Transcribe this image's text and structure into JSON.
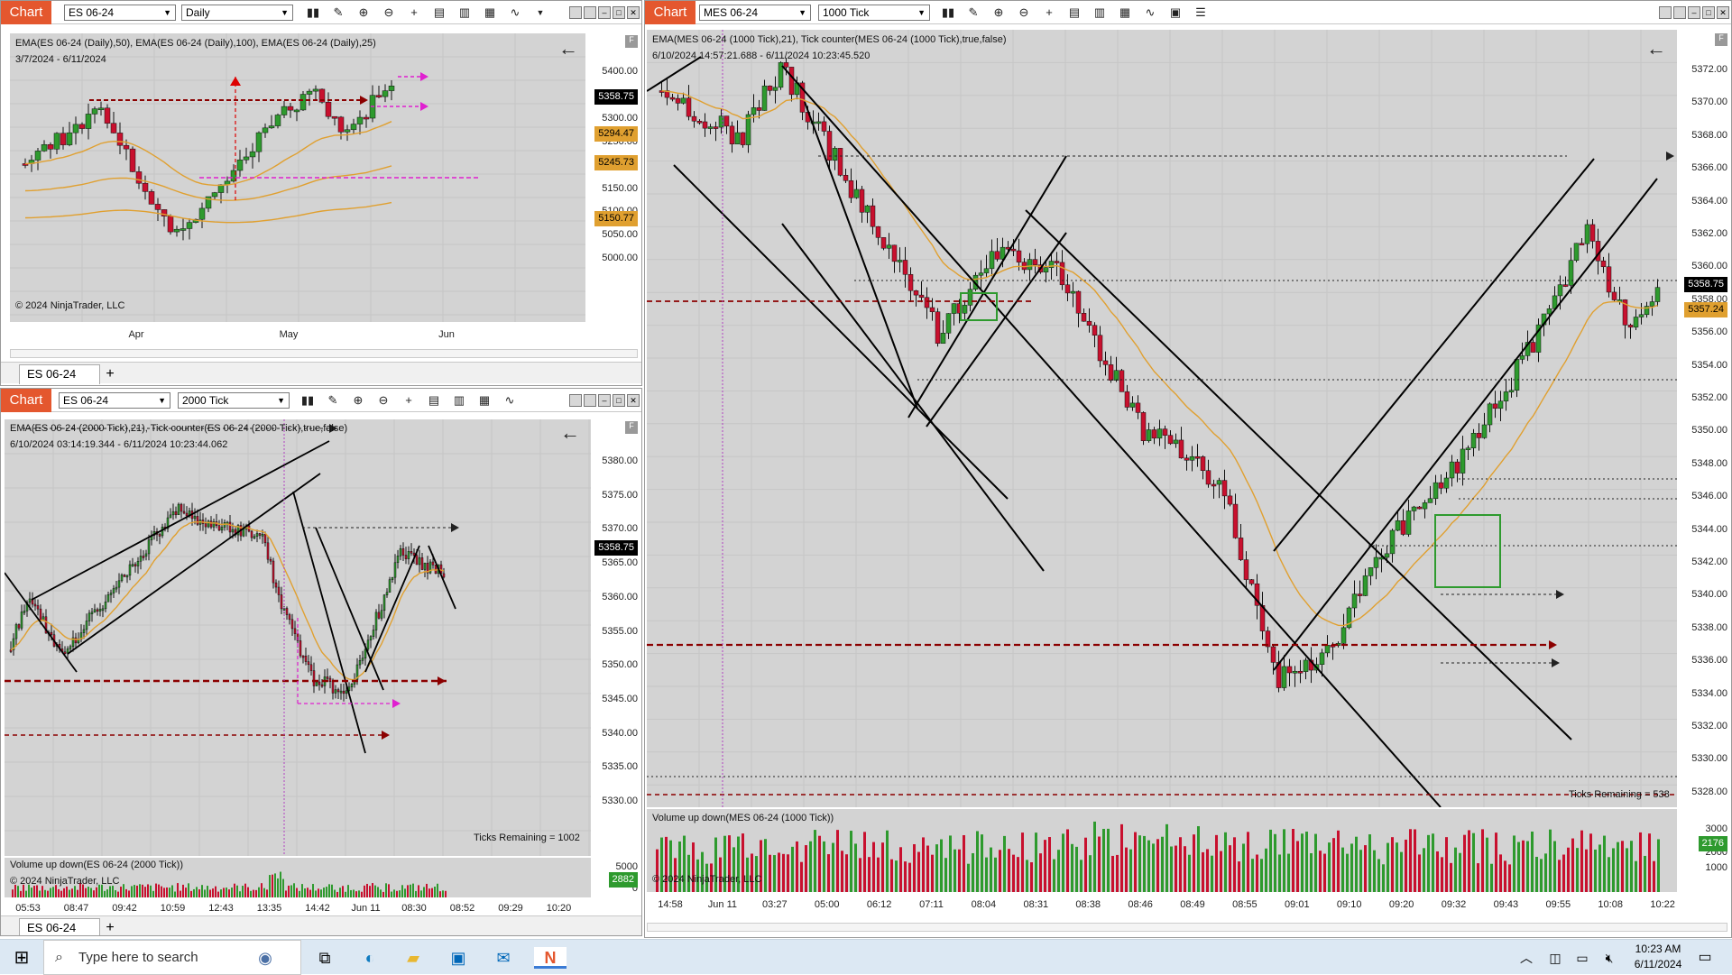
{
  "windows": {
    "top_left": {
      "tag": "Chart",
      "instrument": "ES 06-24",
      "period": "Daily",
      "indicator_label": "EMA(ES 06-24 (Daily),50), EMA(ES 06-24 (Daily),100), EMA(ES 06-24 (Daily),25)",
      "date_range": "3/7/2024 - 6/11/2024",
      "copyright": "© 2024 NinjaTrader, LLC",
      "y_ticks": [
        "5400.00",
        "5350.00",
        "5300.00",
        "5250.00",
        "5200.00",
        "5150.00",
        "5100.00",
        "5050.00",
        "5000.00"
      ],
      "x_ticks": [
        "Apr",
        "May",
        "Jun"
      ],
      "price_badges": [
        "5358.75",
        "5294.47",
        "5245.73",
        "5150.77"
      ],
      "tab": "ES 06-24"
    },
    "bottom_left": {
      "tag": "Chart",
      "instrument": "ES 06-24",
      "period": "2000 Tick",
      "indicator_label": "EMA(ES 06-24 (2000 Tick),21), Tick counter(ES 06-24 (2000 Tick),true,false)",
      "date_range": "6/10/2024 03:14:19.344 - 6/11/2024 10:23:44.062",
      "ticks_remaining": "Ticks Remaining = 1002",
      "volume_label": "Volume up down(ES 06-24 (2000 Tick))",
      "copyright": "© 2024 NinjaTrader, LLC",
      "y_ticks": [
        "5380.00",
        "5375.00",
        "5370.00",
        "5365.00",
        "5360.00",
        "5355.00",
        "5350.00",
        "5345.00",
        "5340.00",
        "5335.00",
        "5330.00"
      ],
      "vol_ticks": [
        "5000",
        "0"
      ],
      "x_ticks": [
        "05:53",
        "08:47",
        "09:42",
        "10:59",
        "12:43",
        "13:35",
        "14:42",
        "Jun 11",
        "08:30",
        "08:52",
        "09:29",
        "10:20"
      ],
      "price_badge": "5358.75",
      "vol_badge": "2882",
      "tab": "ES 06-24"
    },
    "right": {
      "tag": "Chart",
      "instrument": "MES 06-24",
      "period": "1000 Tick",
      "indicator_label": "EMA(MES 06-24 (1000 Tick),21), Tick counter(MES 06-24 (1000 Tick),true,false)",
      "date_range": "6/10/2024 14:57:21.688 - 6/11/2024 10:23:45.520",
      "ticks_remaining": "Ticks Remaining = 538",
      "volume_label": "Volume up down(MES 06-24 (1000 Tick))",
      "copyright": "© 2024 NinjaTrader, LLC",
      "y_ticks": [
        "5372.00",
        "5370.00",
        "5368.00",
        "5366.00",
        "5364.00",
        "5362.00",
        "5360.00",
        "5358.00",
        "5356.00",
        "5354.00",
        "5352.00",
        "5350.00",
        "5348.00",
        "5346.00",
        "5344.00",
        "5342.00",
        "5340.00",
        "5338.00",
        "5336.00",
        "5334.00",
        "5332.00",
        "5330.00",
        "5328.00"
      ],
      "vol_ticks": [
        "3000",
        "2000",
        "1000"
      ],
      "x_ticks": [
        "14:58",
        "Jun 11",
        "03:27",
        "05:00",
        "06:12",
        "07:11",
        "08:04",
        "08:31",
        "08:38",
        "08:46",
        "08:49",
        "08:55",
        "09:01",
        "09:10",
        "09:20",
        "09:32",
        "09:43",
        "09:55",
        "10:08",
        "10:22"
      ],
      "price_badges": [
        "5358.75",
        "5357.24"
      ],
      "vol_badge": "2176"
    }
  },
  "taskbar": {
    "search_placeholder": "Type here to search",
    "time": "10:23 AM",
    "date": "6/11/2024"
  },
  "colors": {
    "chart_tag": "#e4572e",
    "plot_bg": "#d3d3d3",
    "up_candle": "#2e9a2e",
    "down_candle": "#c8102e",
    "ema": "#e0a030",
    "magenta": "#e020d0",
    "dark_red": "#8b0000"
  }
}
